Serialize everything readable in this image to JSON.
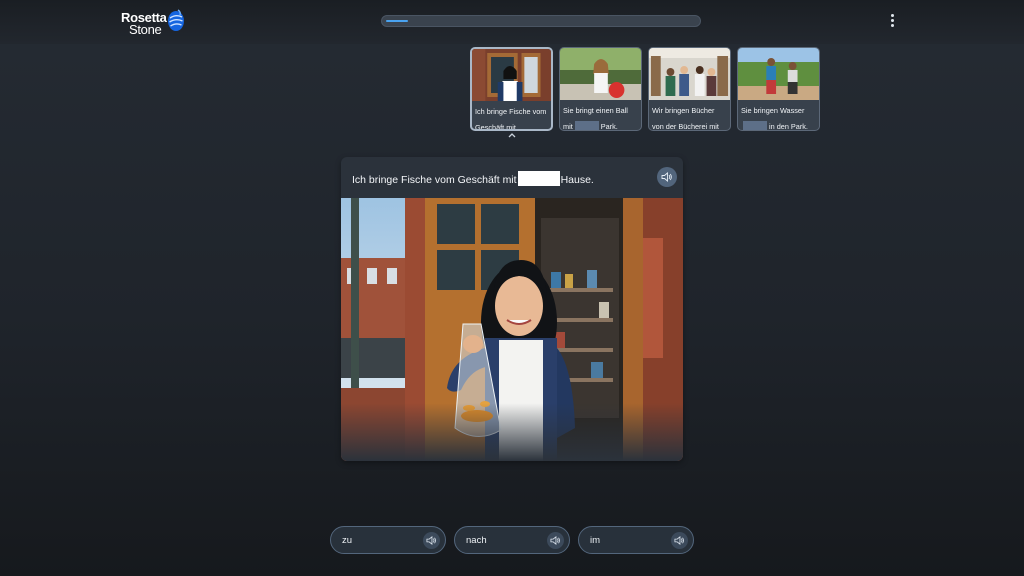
{
  "app": {
    "logo_line1": "Rosetta",
    "logo_line2": "Stone"
  },
  "progress": {
    "fraction": 0.07
  },
  "thumbnails": [
    {
      "text_before": "Ich bringe Fische vom Geschäft mit",
      "text_after": "",
      "active": true
    },
    {
      "text_before": "Sie bringt einen Ball mit",
      "text_after": "Park.",
      "active": false
    },
    {
      "text_before": "Wir bringen Bücher von der Bücherei mit",
      "text_after": "",
      "active": false
    },
    {
      "text_before": "Sie bringen Wasser",
      "text_after": "in den Park.",
      "active": false
    }
  ],
  "prompt": {
    "before": "Ich bringe Fische vom Geschäft mit",
    "after": "Hause."
  },
  "answers": [
    {
      "label": "zu"
    },
    {
      "label": "nach"
    },
    {
      "label": "im"
    }
  ],
  "icons": {
    "logo": "rosetta-stone-logo-icon",
    "menu": "more-vertical-icon",
    "speaker": "speaker-icon",
    "collapse": "chevron-up-icon"
  },
  "colors": {
    "accent": "#4aa3f0",
    "background": "#1f242b",
    "blank_fill": "#ffffff"
  }
}
